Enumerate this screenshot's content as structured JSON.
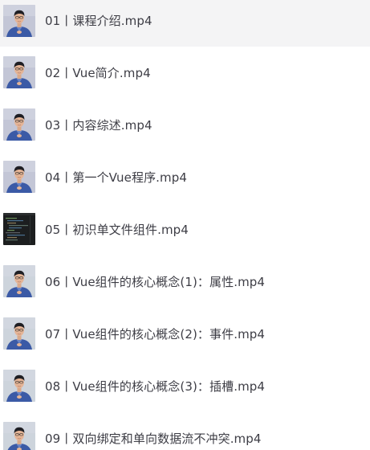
{
  "videos": [
    {
      "title": "01丨课程介绍.mp4",
      "thumbnail": "person-avatar",
      "highlighted": true
    },
    {
      "title": "02丨Vue简介.mp4",
      "thumbnail": "person-avatar",
      "highlighted": false
    },
    {
      "title": "03丨内容综述.mp4",
      "thumbnail": "person-avatar",
      "highlighted": false
    },
    {
      "title": "04丨第一个Vue程序.mp4",
      "thumbnail": "person-avatar",
      "highlighted": false
    },
    {
      "title": "05丨初识单文件组件.mp4",
      "thumbnail": "code-editor",
      "highlighted": false
    },
    {
      "title": "06丨Vue组件的核心概念(1)：属性.mp4",
      "thumbnail": "person-avatar",
      "highlighted": false
    },
    {
      "title": "07丨Vue组件的核心概念(2)：事件.mp4",
      "thumbnail": "person-avatar",
      "highlighted": false
    },
    {
      "title": "08丨Vue组件的核心概念(3)：插槽.mp4",
      "thumbnail": "person-avatar",
      "highlighted": false
    },
    {
      "title": "09丨双向绑定和单向数据流不冲突.mp4",
      "thumbnail": "person-avatar",
      "highlighted": false
    }
  ],
  "colors": {
    "row_highlight": "#f4f4f5",
    "text": "#3d3d45"
  }
}
